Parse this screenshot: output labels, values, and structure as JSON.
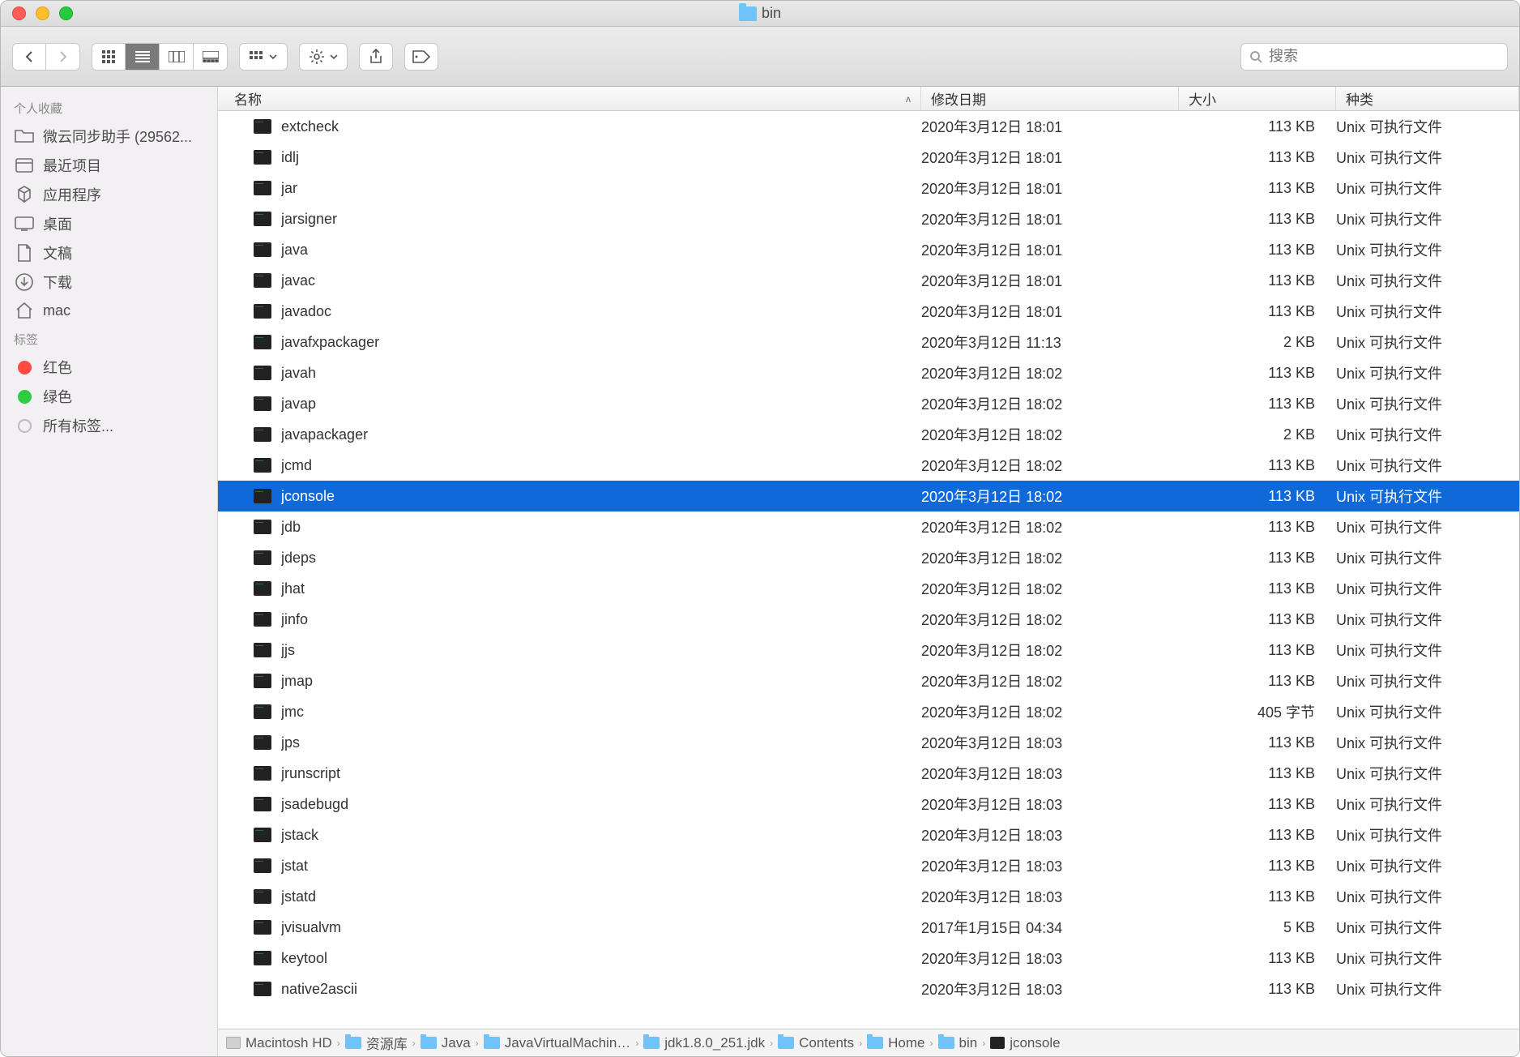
{
  "window": {
    "title": "bin"
  },
  "toolbar": {
    "search_placeholder": "搜索"
  },
  "sidebar": {
    "favorites_heading": "个人收藏",
    "favorites": [
      {
        "label": "微云同步助手 (29562...",
        "icon": "folder"
      },
      {
        "label": "最近项目",
        "icon": "recents"
      },
      {
        "label": "应用程序",
        "icon": "apps"
      },
      {
        "label": "桌面",
        "icon": "desktop"
      },
      {
        "label": "文稿",
        "icon": "documents"
      },
      {
        "label": "下载",
        "icon": "downloads"
      },
      {
        "label": "mac",
        "icon": "home"
      }
    ],
    "tags_heading": "标签",
    "tags": [
      {
        "label": "红色",
        "color": "red"
      },
      {
        "label": "绿色",
        "color": "green"
      },
      {
        "label": "所有标签...",
        "color": "grey"
      }
    ]
  },
  "columns": {
    "name": "名称",
    "date": "修改日期",
    "size": "大小",
    "kind": "种类"
  },
  "files": [
    {
      "name": "extcheck",
      "date": "2020年3月12日 18:01",
      "size": "113 KB",
      "kind": "Unix 可执行文件"
    },
    {
      "name": "idlj",
      "date": "2020年3月12日 18:01",
      "size": "113 KB",
      "kind": "Unix 可执行文件"
    },
    {
      "name": "jar",
      "date": "2020年3月12日 18:01",
      "size": "113 KB",
      "kind": "Unix 可执行文件"
    },
    {
      "name": "jarsigner",
      "date": "2020年3月12日 18:01",
      "size": "113 KB",
      "kind": "Unix 可执行文件"
    },
    {
      "name": "java",
      "date": "2020年3月12日 18:01",
      "size": "113 KB",
      "kind": "Unix 可执行文件"
    },
    {
      "name": "javac",
      "date": "2020年3月12日 18:01",
      "size": "113 KB",
      "kind": "Unix 可执行文件"
    },
    {
      "name": "javadoc",
      "date": "2020年3月12日 18:01",
      "size": "113 KB",
      "kind": "Unix 可执行文件"
    },
    {
      "name": "javafxpackager",
      "date": "2020年3月12日 11:13",
      "size": "2 KB",
      "kind": "Unix 可执行文件"
    },
    {
      "name": "javah",
      "date": "2020年3月12日 18:02",
      "size": "113 KB",
      "kind": "Unix 可执行文件"
    },
    {
      "name": "javap",
      "date": "2020年3月12日 18:02",
      "size": "113 KB",
      "kind": "Unix 可执行文件"
    },
    {
      "name": "javapackager",
      "date": "2020年3月12日 18:02",
      "size": "2 KB",
      "kind": "Unix 可执行文件"
    },
    {
      "name": "jcmd",
      "date": "2020年3月12日 18:02",
      "size": "113 KB",
      "kind": "Unix 可执行文件"
    },
    {
      "name": "jconsole",
      "date": "2020年3月12日 18:02",
      "size": "113 KB",
      "kind": "Unix 可执行文件",
      "selected": true
    },
    {
      "name": "jdb",
      "date": "2020年3月12日 18:02",
      "size": "113 KB",
      "kind": "Unix 可执行文件"
    },
    {
      "name": "jdeps",
      "date": "2020年3月12日 18:02",
      "size": "113 KB",
      "kind": "Unix 可执行文件"
    },
    {
      "name": "jhat",
      "date": "2020年3月12日 18:02",
      "size": "113 KB",
      "kind": "Unix 可执行文件"
    },
    {
      "name": "jinfo",
      "date": "2020年3月12日 18:02",
      "size": "113 KB",
      "kind": "Unix 可执行文件"
    },
    {
      "name": "jjs",
      "date": "2020年3月12日 18:02",
      "size": "113 KB",
      "kind": "Unix 可执行文件"
    },
    {
      "name": "jmap",
      "date": "2020年3月12日 18:02",
      "size": "113 KB",
      "kind": "Unix 可执行文件"
    },
    {
      "name": "jmc",
      "date": "2020年3月12日 18:02",
      "size": "405 字节",
      "kind": "Unix 可执行文件"
    },
    {
      "name": "jps",
      "date": "2020年3月12日 18:03",
      "size": "113 KB",
      "kind": "Unix 可执行文件"
    },
    {
      "name": "jrunscript",
      "date": "2020年3月12日 18:03",
      "size": "113 KB",
      "kind": "Unix 可执行文件"
    },
    {
      "name": "jsadebugd",
      "date": "2020年3月12日 18:03",
      "size": "113 KB",
      "kind": "Unix 可执行文件"
    },
    {
      "name": "jstack",
      "date": "2020年3月12日 18:03",
      "size": "113 KB",
      "kind": "Unix 可执行文件"
    },
    {
      "name": "jstat",
      "date": "2020年3月12日 18:03",
      "size": "113 KB",
      "kind": "Unix 可执行文件"
    },
    {
      "name": "jstatd",
      "date": "2020年3月12日 18:03",
      "size": "113 KB",
      "kind": "Unix 可执行文件"
    },
    {
      "name": "jvisualvm",
      "date": "2017年1月15日 04:34",
      "size": "5 KB",
      "kind": "Unix 可执行文件"
    },
    {
      "name": "keytool",
      "date": "2020年3月12日 18:03",
      "size": "113 KB",
      "kind": "Unix 可执行文件"
    },
    {
      "name": "native2ascii",
      "date": "2020年3月12日 18:03",
      "size": "113 KB",
      "kind": "Unix 可执行文件"
    }
  ],
  "path": [
    {
      "label": "Macintosh HD",
      "icon": "hd"
    },
    {
      "label": "资源库",
      "icon": "folder"
    },
    {
      "label": "Java",
      "icon": "folder"
    },
    {
      "label": "JavaVirtualMachin…",
      "icon": "folder"
    },
    {
      "label": "jdk1.8.0_251.jdk",
      "icon": "folder"
    },
    {
      "label": "Contents",
      "icon": "folder"
    },
    {
      "label": "Home",
      "icon": "folder"
    },
    {
      "label": "bin",
      "icon": "folder"
    },
    {
      "label": "jconsole",
      "icon": "exec"
    }
  ]
}
